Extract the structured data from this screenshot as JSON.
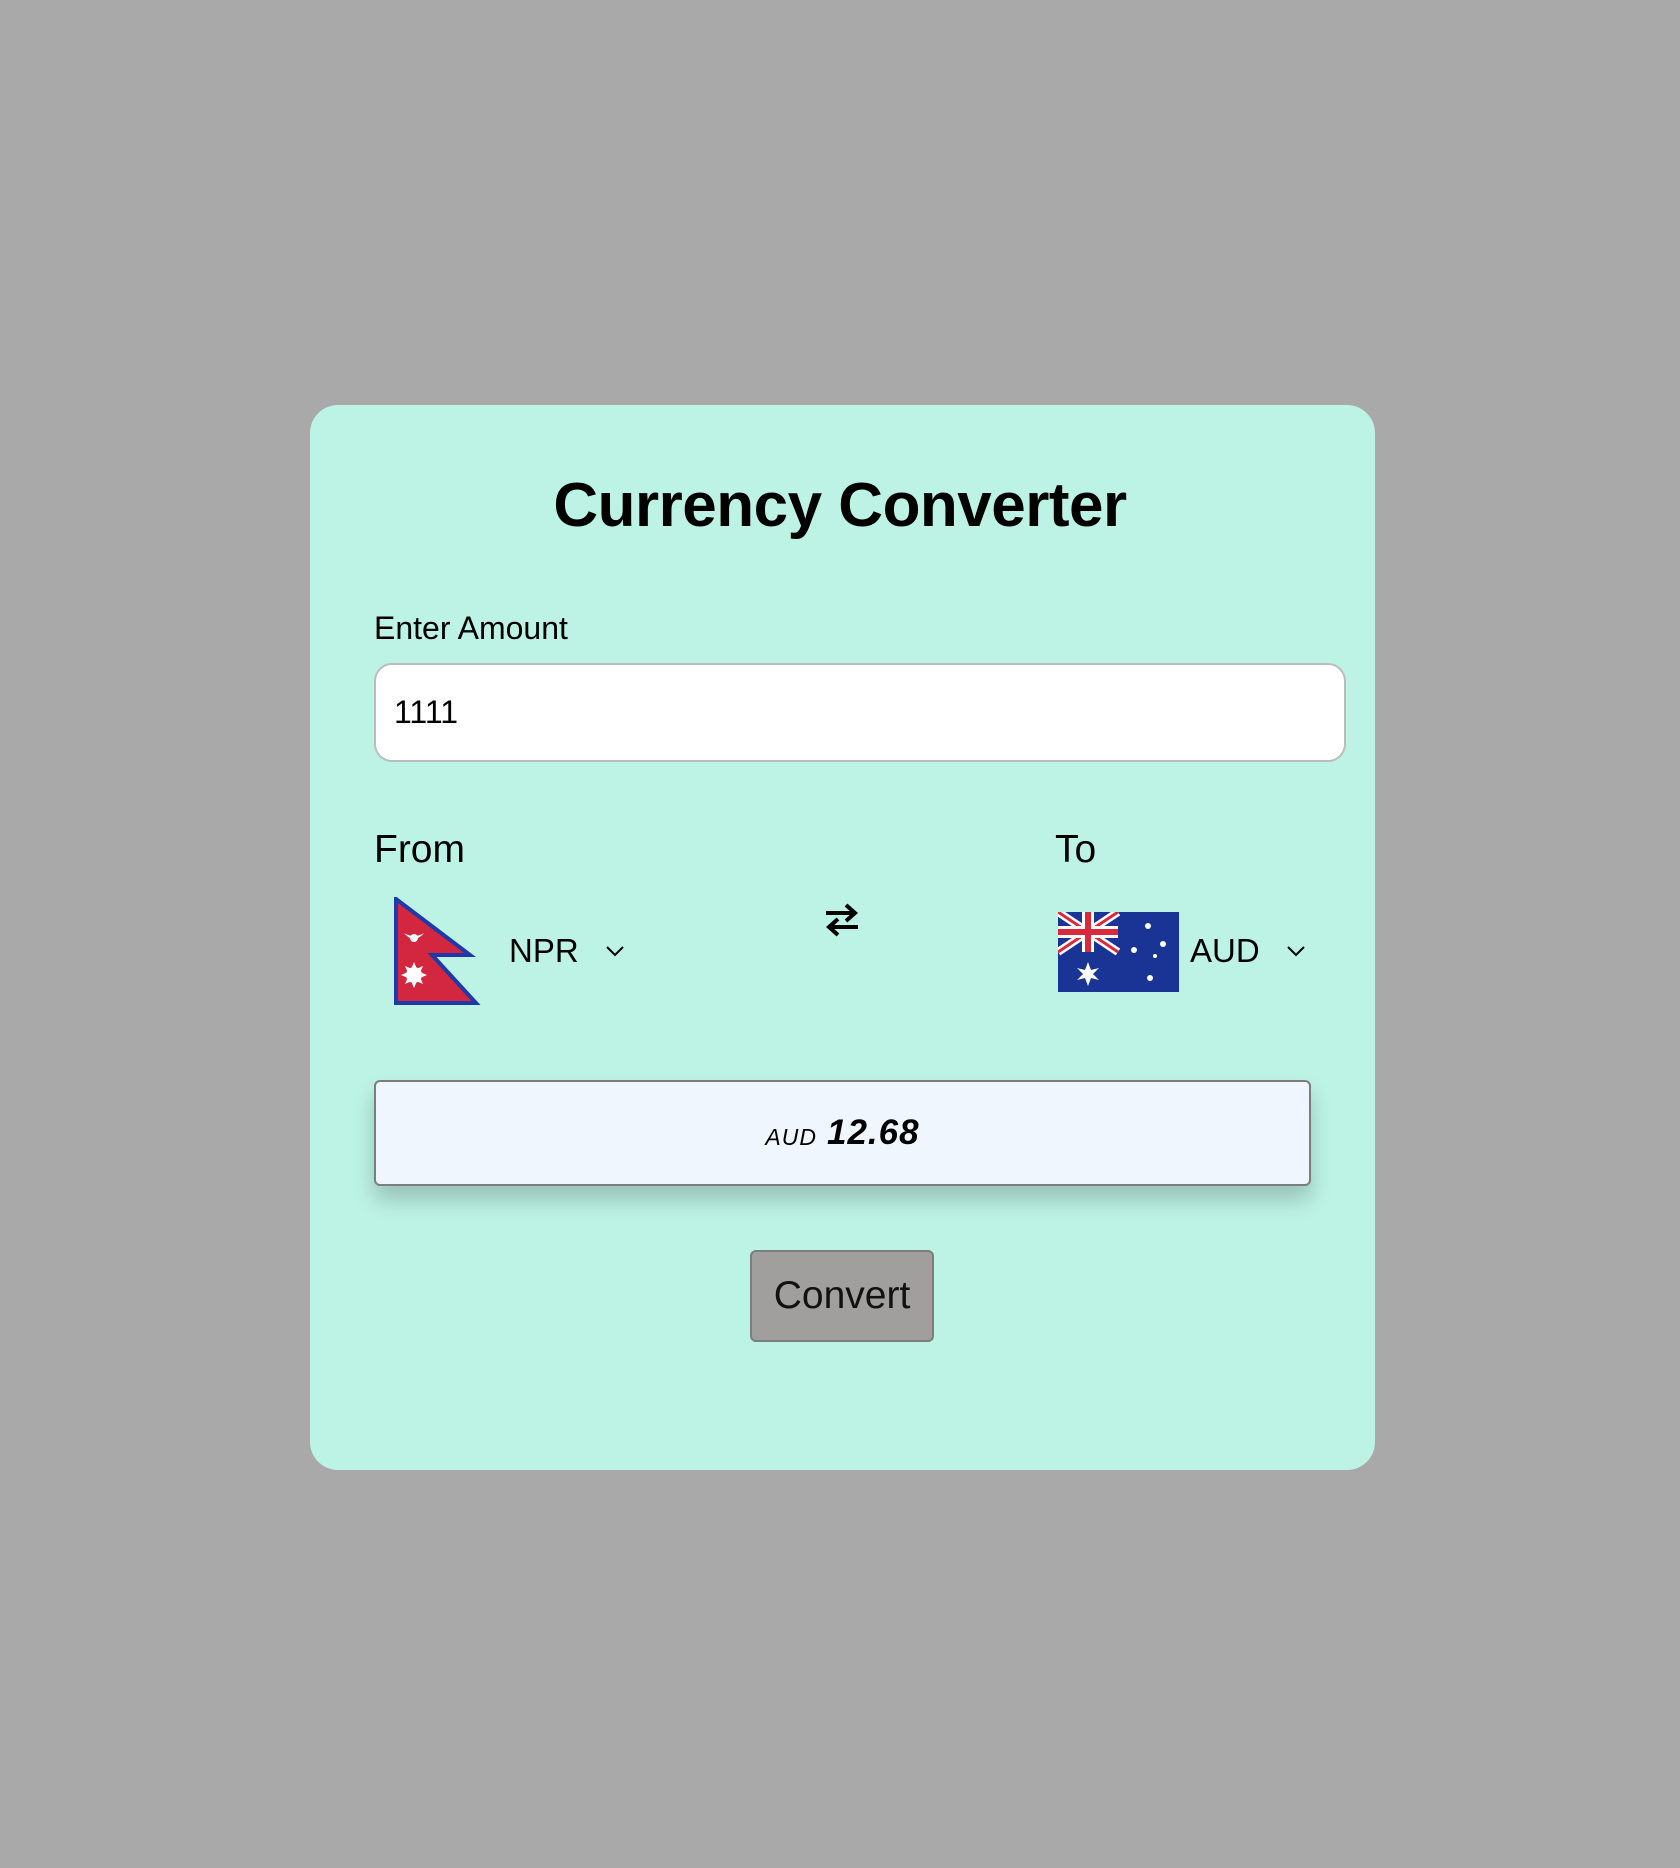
{
  "converter": {
    "title": "Currency Converter",
    "amount_label": "Enter Amount",
    "amount_value": "1111",
    "from_label": "From",
    "to_label": "To",
    "from_currency": "NPR",
    "to_currency": "AUD",
    "result_currency": "AUD",
    "result_value": "12.68",
    "convert_label": "Convert"
  },
  "icons": {
    "from_flag": "nepal-flag-icon",
    "to_flag": "australia-flag-icon",
    "swap": "swap-arrows-icon",
    "dropdown": "chevron-down-icon"
  },
  "colors": {
    "page_background": "#a9a9a9",
    "card_background": "#bdf3e5",
    "result_background": "#eff6fd",
    "button_background": "#a19e9e",
    "nepal_red": "#d2273f",
    "nepal_blue": "#1f3aa8",
    "australia_blue": "#1a3496",
    "australia_red": "#d92a3c"
  }
}
